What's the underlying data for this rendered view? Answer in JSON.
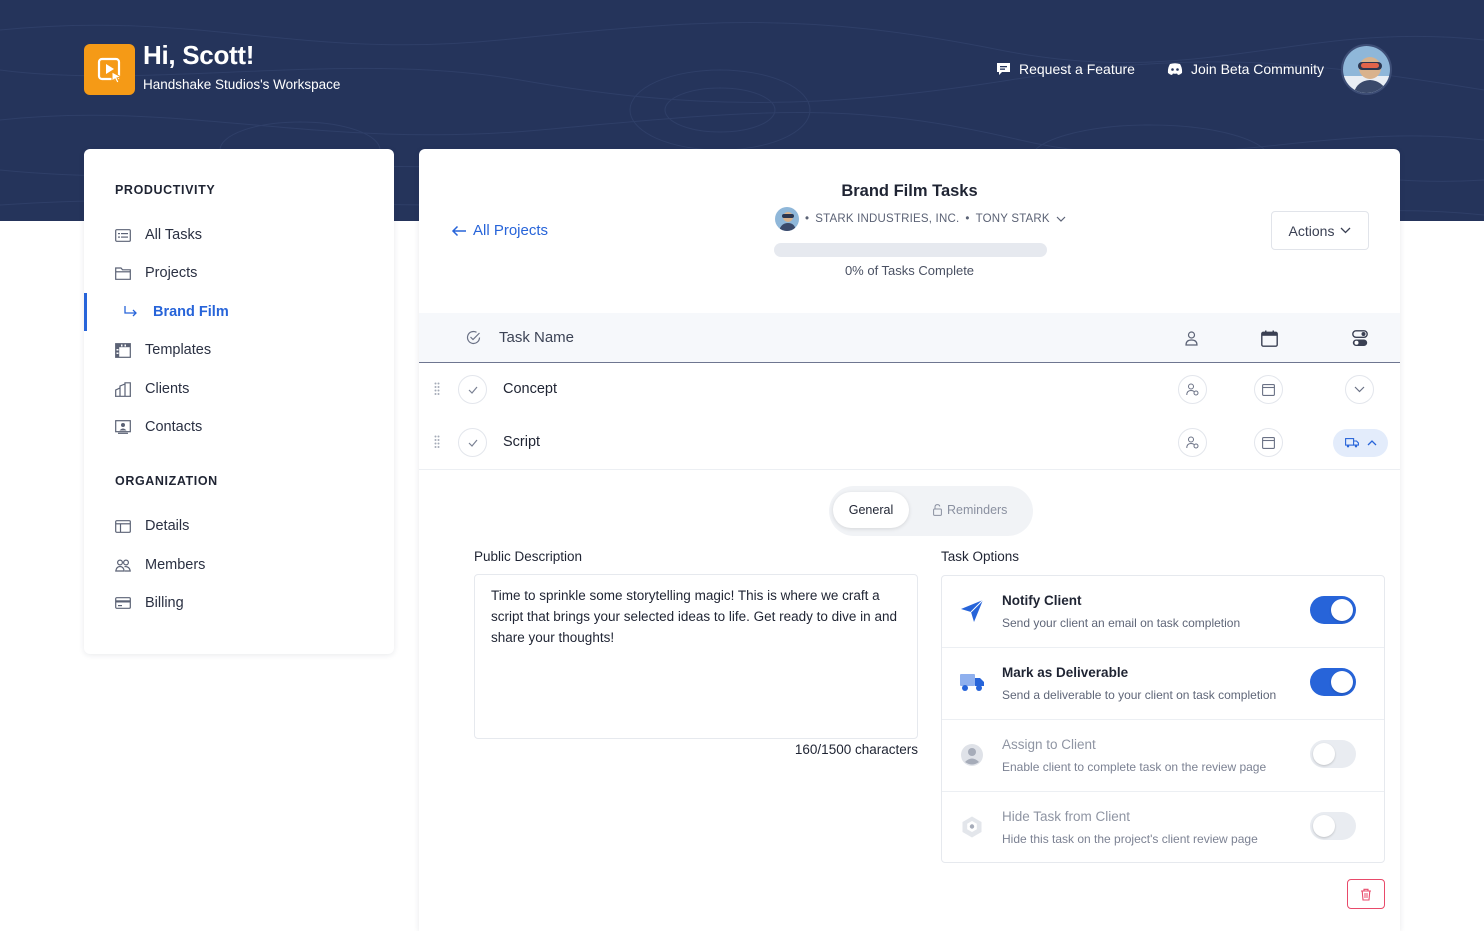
{
  "header": {
    "greeting": "Hi, Scott!",
    "workspace": "Handshake Studios's Workspace",
    "request_feature": "Request a Feature",
    "join_community": "Join Beta Community"
  },
  "sidebar": {
    "productivity_title": "PRODUCTIVITY",
    "organization_title": "ORGANIZATION",
    "items": [
      {
        "label": "All Tasks",
        "icon": "list-icon"
      },
      {
        "label": "Projects",
        "icon": "folder-icon"
      },
      {
        "label": "Brand Film",
        "icon": "subdirectory-arrow-icon",
        "active": true
      },
      {
        "label": "Templates",
        "icon": "film-strip-icon"
      },
      {
        "label": "Clients",
        "icon": "building-icon"
      },
      {
        "label": "Contacts",
        "icon": "contact-card-icon"
      }
    ],
    "org_items": [
      {
        "label": "Details",
        "icon": "window-icon"
      },
      {
        "label": "Members",
        "icon": "users-icon"
      },
      {
        "label": "Billing",
        "icon": "credit-card-icon"
      }
    ]
  },
  "project": {
    "back_label": "All Projects",
    "title": "Brand Film Tasks",
    "client": "STARK INDUSTRIES, INC.",
    "contact": "TONY STARK",
    "progress_percent": 0,
    "progress_text": "0% of Tasks Complete",
    "actions_label": "Actions"
  },
  "table": {
    "column_name": "Task Name",
    "rows": [
      {
        "name": "Concept"
      },
      {
        "name": "Script"
      }
    ]
  },
  "detail": {
    "tabs": {
      "general": "General",
      "reminders": "Reminders"
    },
    "public_description_label": "Public Description",
    "description": "Time to sprinkle some storytelling magic! This is where we craft a script that brings your selected ideas to life. Get ready to dive in and share your thoughts!",
    "char_count": "160/1500 characters",
    "task_options_label": "Task Options",
    "options": [
      {
        "title": "Notify Client",
        "sub": "Send your client an email on task completion",
        "on": true
      },
      {
        "title": "Mark as Deliverable",
        "sub": "Send a deliverable to your client on task completion",
        "on": true
      },
      {
        "title": "Assign to Client",
        "sub": "Enable client to complete task on the review page",
        "on": false
      },
      {
        "title": "Hide Task from Client",
        "sub": "Hide this task on the project's client review page",
        "on": false
      }
    ]
  },
  "colors": {
    "header_bg": "#25345b",
    "accent": "#2764d9",
    "logo": "#f59a16",
    "danger": "#e84a6a"
  }
}
